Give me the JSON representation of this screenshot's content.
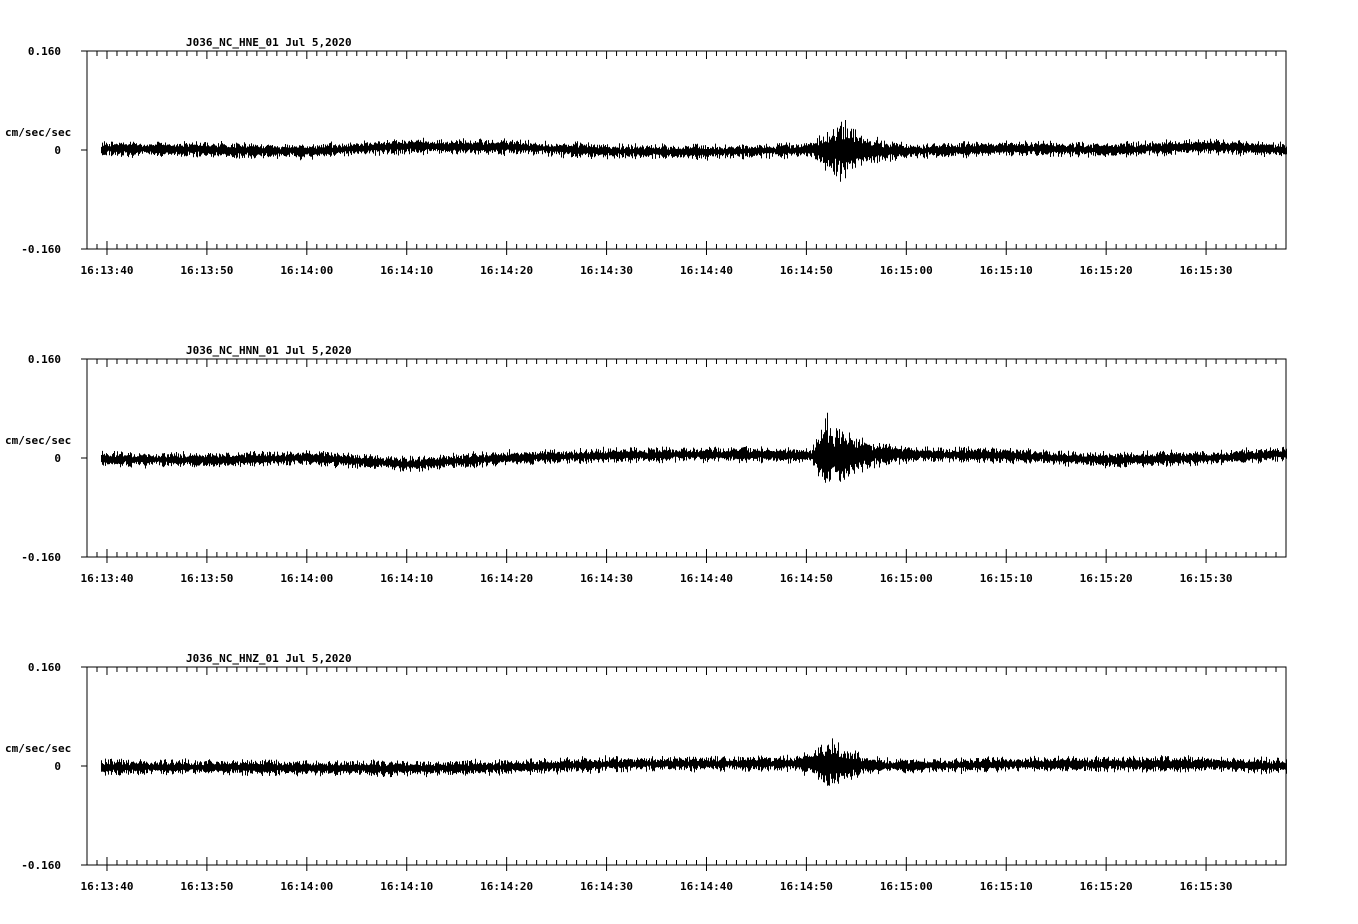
{
  "chart_data": [
    {
      "type": "line",
      "title": "J036_NC_HNE_01   Jul 5,2020",
      "ylabel": "cm/sec/sec",
      "ytick_labels": [
        "0.160",
        "0",
        "-0.160"
      ],
      "ylim": [
        -0.16,
        0.16
      ],
      "x_start": "16:13:38",
      "x_end": "16:15:38",
      "xtick_labels": [
        "16:13:40",
        "16:13:50",
        "16:14:00",
        "16:14:10",
        "16:14:20",
        "16:14:30",
        "16:14:40",
        "16:14:50",
        "16:15:00",
        "16:15:10",
        "16:15:20",
        "16:15:30"
      ],
      "trace": {
        "start": "16:13:39.5",
        "end": "16:15:38",
        "noise_amplitude": 0.015,
        "drift": [
          {
            "t": "16:13:39.5",
            "v": 0.002
          },
          {
            "t": "16:13:50",
            "v": 0.0
          },
          {
            "t": "16:14:00",
            "v": -0.002
          },
          {
            "t": "16:14:10",
            "v": 0.006
          },
          {
            "t": "16:14:20",
            "v": 0.005
          },
          {
            "t": "16:14:30",
            "v": -0.002
          },
          {
            "t": "16:14:40",
            "v": -0.003
          },
          {
            "t": "16:14:50",
            "v": 0.0
          },
          {
            "t": "16:15:00",
            "v": -0.002
          },
          {
            "t": "16:15:10",
            "v": 0.003
          },
          {
            "t": "16:15:20",
            "v": 0.0
          },
          {
            "t": "16:15:30",
            "v": 0.006
          },
          {
            "t": "16:15:38",
            "v": 0.0
          }
        ],
        "event": {
          "onset": "16:14:50.5",
          "peak": "16:14:53.5",
          "end": "16:15:00",
          "peak_amplitude": 0.05
        }
      }
    },
    {
      "type": "line",
      "title": "J036_NC_HNN_01   Jul 5,2020",
      "ylabel": "cm/sec/sec",
      "ytick_labels": [
        "0.160",
        "0",
        "-0.160"
      ],
      "ylim": [
        -0.16,
        0.16
      ],
      "x_start": "16:13:38",
      "x_end": "16:15:38",
      "xtick_labels": [
        "16:13:40",
        "16:13:50",
        "16:14:00",
        "16:14:10",
        "16:14:20",
        "16:14:30",
        "16:14:40",
        "16:14:50",
        "16:15:00",
        "16:15:10",
        "16:15:20",
        "16:15:30"
      ],
      "trace": {
        "start": "16:13:39.5",
        "end": "16:15:38",
        "noise_amplitude": 0.015,
        "drift": [
          {
            "t": "16:13:39.5",
            "v": -0.002
          },
          {
            "t": "16:13:50",
            "v": -0.003
          },
          {
            "t": "16:14:00",
            "v": 0.0
          },
          {
            "t": "16:14:10",
            "v": -0.01
          },
          {
            "t": "16:14:20",
            "v": 0.0
          },
          {
            "t": "16:14:30",
            "v": 0.004
          },
          {
            "t": "16:14:40",
            "v": 0.006
          },
          {
            "t": "16:14:50",
            "v": 0.004
          },
          {
            "t": "16:15:00",
            "v": 0.006
          },
          {
            "t": "16:15:10",
            "v": 0.004
          },
          {
            "t": "16:15:20",
            "v": -0.003
          },
          {
            "t": "16:15:30",
            "v": 0.0
          },
          {
            "t": "16:15:38",
            "v": 0.006
          }
        ],
        "event": {
          "onset": "16:14:50.5",
          "peak": "16:14:52",
          "end": "16:15:00",
          "peak_amplitude": 0.07
        }
      }
    },
    {
      "type": "line",
      "title": "J036_NC_HNZ_01   Jul 5,2020",
      "ylabel": "cm/sec/sec",
      "ytick_labels": [
        "0.160",
        "0",
        "-0.160"
      ],
      "ylim": [
        -0.16,
        0.16
      ],
      "x_start": "16:13:38",
      "x_end": "16:15:38",
      "xtick_labels": [
        "16:13:40",
        "16:13:50",
        "16:14:00",
        "16:14:10",
        "16:14:20",
        "16:14:30",
        "16:14:40",
        "16:14:50",
        "16:15:00",
        "16:15:10",
        "16:15:20",
        "16:15:30"
      ],
      "trace": {
        "start": "16:13:39.5",
        "end": "16:15:38",
        "noise_amplitude": 0.015,
        "drift": [
          {
            "t": "16:13:39.5",
            "v": -0.002
          },
          {
            "t": "16:13:50",
            "v": -0.002
          },
          {
            "t": "16:14:00",
            "v": -0.003
          },
          {
            "t": "16:14:10",
            "v": -0.004
          },
          {
            "t": "16:14:20",
            "v": -0.002
          },
          {
            "t": "16:14:30",
            "v": 0.003
          },
          {
            "t": "16:14:40",
            "v": 0.004
          },
          {
            "t": "16:14:50",
            "v": 0.004
          },
          {
            "t": "16:15:00",
            "v": 0.0
          },
          {
            "t": "16:15:10",
            "v": 0.003
          },
          {
            "t": "16:15:20",
            "v": 0.003
          },
          {
            "t": "16:15:30",
            "v": 0.003
          },
          {
            "t": "16:15:38",
            "v": 0.0
          }
        ],
        "event": {
          "onset": "16:14:49",
          "peak": "16:14:52.5",
          "end": "16:14:58",
          "peak_amplitude": 0.04
        }
      }
    }
  ]
}
